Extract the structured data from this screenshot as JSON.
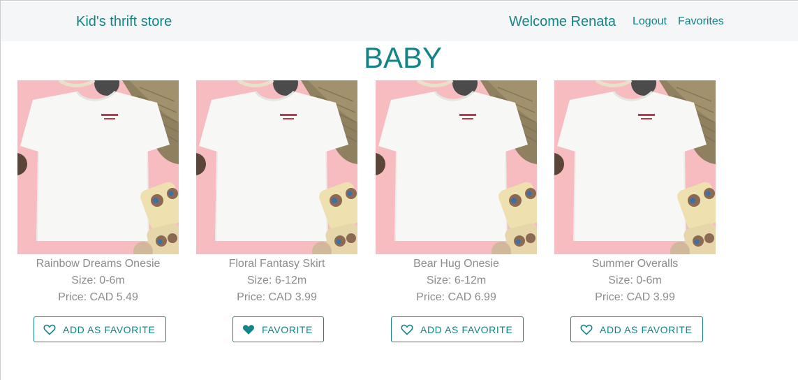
{
  "navbar": {
    "brand": "Kid's thrift store",
    "welcome": "Welcome Renata",
    "logout": "Logout",
    "favorites": "Favorites"
  },
  "page": {
    "title": "BABY"
  },
  "colors": {
    "accent": "#138487",
    "muted_text": "#8c8c8c",
    "navbar_bg": "#f4f6f8",
    "image_bg": "#f6bcc0"
  },
  "products": [
    {
      "name": "Rainbow Dreams Onesie",
      "size": "Size: 0-6m",
      "price": "Price: CAD 5.49",
      "button_label": "ADD AS FAVORITE",
      "favorited": false,
      "icon": "heart-outline-icon"
    },
    {
      "name": "Floral Fantasy Skirt",
      "size": "Size: 6-12m",
      "price": "Price: CAD 3.99",
      "button_label": "FAVORITE",
      "favorited": true,
      "icon": "heart-filled-icon"
    },
    {
      "name": "Bear Hug Onesie",
      "size": "Size: 6-12m",
      "price": "Price: CAD 6.99",
      "button_label": "ADD AS FAVORITE",
      "favorited": false,
      "icon": "heart-outline-icon"
    },
    {
      "name": "Summer Overalls",
      "size": "Size: 0-6m",
      "price": "Price: CAD 3.99",
      "button_label": "ADD AS FAVORITE",
      "favorited": false,
      "icon": "heart-outline-icon"
    }
  ]
}
